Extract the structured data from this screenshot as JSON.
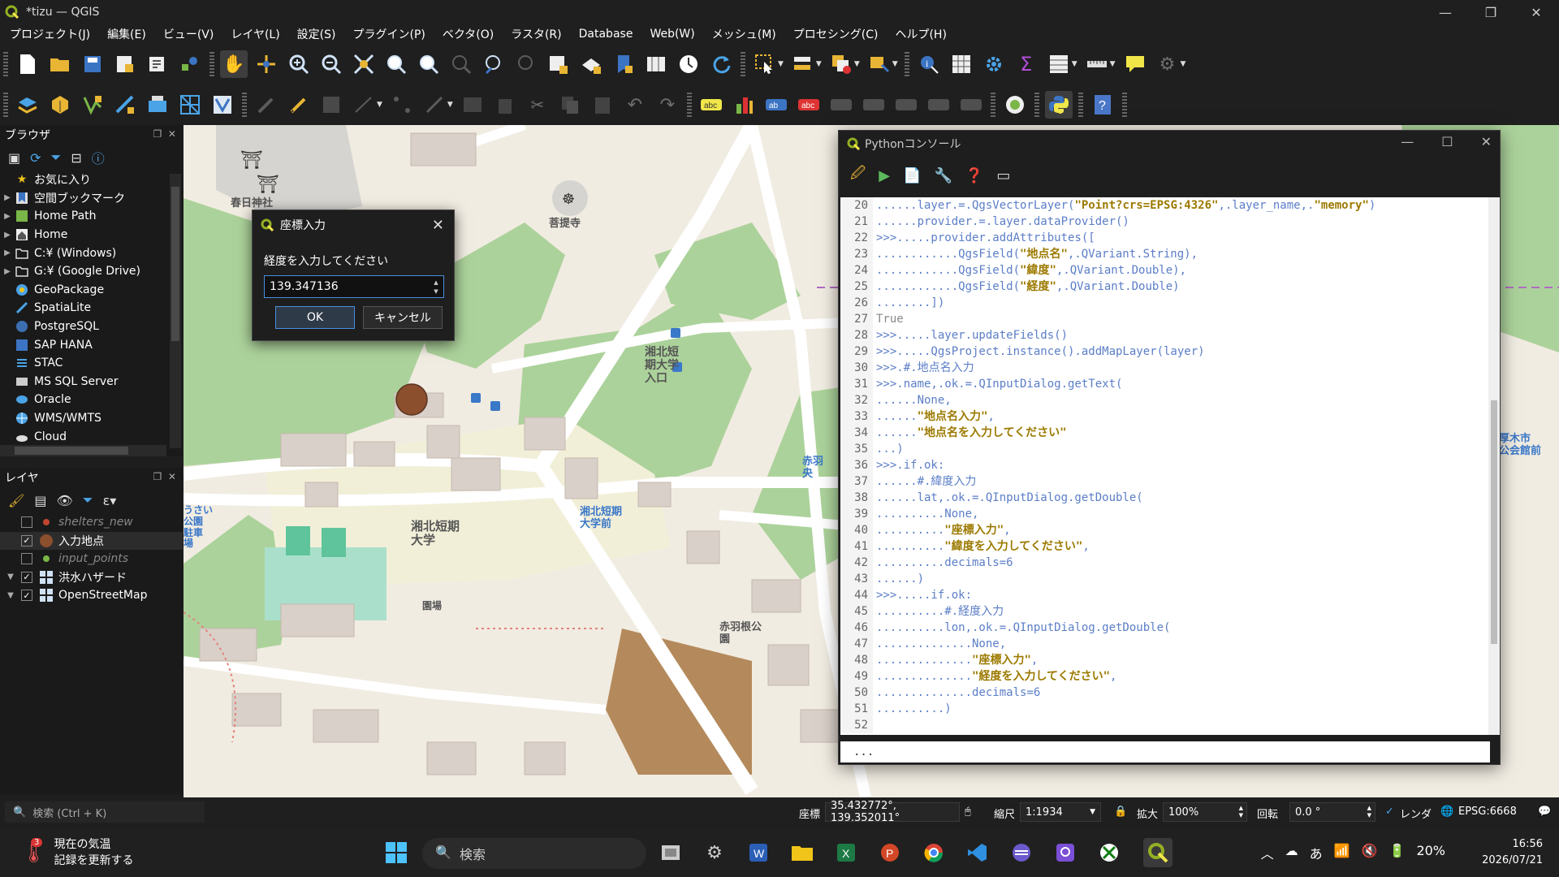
{
  "app": {
    "window_title": "*tizu — QGIS"
  },
  "menu": [
    "プロジェクト(J)",
    "編集(E)",
    "ビュー(V)",
    "レイヤ(L)",
    "設定(S)",
    "プラグイン(P)",
    "ベクタ(O)",
    "ラスタ(R)",
    "Database",
    "Web(W)",
    "メッシュ(M)",
    "プロセシング(C)",
    "ヘルプ(H)"
  ],
  "browser": {
    "title": "ブラウザ",
    "items": [
      "お気に入り",
      "空間ブックマーク",
      "Home Path",
      "Home",
      "C:¥ (Windows)",
      "G:¥ (Google Drive)",
      "GeoPackage",
      "SpatiaLite",
      "PostgreSQL",
      "SAP HANA",
      "STAC",
      "MS SQL Server",
      "Oracle",
      "WMS/WMTS",
      "Cloud"
    ]
  },
  "layers": {
    "title": "レイヤ",
    "items": [
      {
        "name": "shelters_new",
        "checked": false
      },
      {
        "name": "入力地点",
        "checked": true
      },
      {
        "name": "input_points",
        "checked": false
      },
      {
        "name": "洪水ハザード",
        "checked": true
      },
      {
        "name": "OpenStreetMap",
        "checked": true
      }
    ]
  },
  "map": {
    "labels": {
      "shrine": "春日神社",
      "temple": "菩提寺",
      "college": "湘北短期\n大学",
      "college_entrance": "湘北短\n期大学\n入口",
      "bus_stop": "湘北短期\n大学前",
      "park": "赤羽根公\n園",
      "city_hall_hint": "厚木市\n公会館前",
      "akabane": "赤羽\n央",
      "field": "園場",
      "park_left": "うさい\n公園\n駐車\n場"
    },
    "colors": {
      "land": "#f1ece2",
      "forest": "#acd29b",
      "road": "#ffffff",
      "building": "#d9d0c9",
      "marker": "#8b4f2e"
    }
  },
  "dialog": {
    "title": "座標入力",
    "prompt": "経度を入力してください",
    "value": "139.347136",
    "ok_label": "OK",
    "cancel_label": "キャンセル"
  },
  "console": {
    "title": "Pythonコンソール",
    "input_prompt": "...",
    "lines": [
      {
        "n": "20",
        "t": "......layer.=.QgsVectorLayer(\"Point?crs=EPSG:4326\",.layer_name,.\"memory\")"
      },
      {
        "n": "21",
        "t": "......provider.=.layer.dataProvider()"
      },
      {
        "n": "22",
        "t": ">>>.....provider.addAttributes(["
      },
      {
        "n": "23",
        "t": "............QgsField(\"地点名\",.QVariant.String),"
      },
      {
        "n": "24",
        "t": "............QgsField(\"緯度\",.QVariant.Double),"
      },
      {
        "n": "25",
        "t": "............QgsField(\"経度\",.QVariant.Double)"
      },
      {
        "n": "26",
        "t": "........])"
      },
      {
        "n": "27",
        "t": "True"
      },
      {
        "n": "28",
        "t": ">>>.....layer.updateFields()"
      },
      {
        "n": "29",
        "t": ">>>.....QgsProject.instance().addMapLayer(layer)"
      },
      {
        "n": "30",
        "t": ">>>.#.地点名入力"
      },
      {
        "n": "31",
        "t": ">>>.name,.ok.=.QInputDialog.getText("
      },
      {
        "n": "32",
        "t": "......None,"
      },
      {
        "n": "33",
        "t": "......\"地点名入力\","
      },
      {
        "n": "34",
        "t": "......\"地点名を入力してください\""
      },
      {
        "n": "35",
        "t": "...)"
      },
      {
        "n": "36",
        "t": ">>>.if.ok:"
      },
      {
        "n": "37",
        "t": "......#.緯度入力"
      },
      {
        "n": "38",
        "t": "......lat,.ok.=.QInputDialog.getDouble("
      },
      {
        "n": "39",
        "t": "..........None,"
      },
      {
        "n": "40",
        "t": "..........\"座標入力\","
      },
      {
        "n": "41",
        "t": "..........\"緯度を入力してください\","
      },
      {
        "n": "42",
        "t": "..........decimals=6"
      },
      {
        "n": "43",
        "t": "......)"
      },
      {
        "n": "44",
        "t": ">>>.....if.ok:"
      },
      {
        "n": "45",
        "t": "..........#.経度入力"
      },
      {
        "n": "46",
        "t": "..........lon,.ok.=.QInputDialog.getDouble("
      },
      {
        "n": "47",
        "t": "..............None,"
      },
      {
        "n": "48",
        "t": "..............\"座標入力\","
      },
      {
        "n": "49",
        "t": "..............\"経度を入力してください\","
      },
      {
        "n": "50",
        "t": "..............decimals=6"
      },
      {
        "n": "51",
        "t": "..........)"
      },
      {
        "n": "52",
        "t": ""
      }
    ]
  },
  "status": {
    "search_placeholder": "検索 (Ctrl + K)",
    "coord_label": "座標",
    "coord_value": "35.432772°, 139.352011°",
    "scale_label": "縮尺",
    "scale_value": "1:1934",
    "magnify_label": "拡大",
    "magnify_value": "100%",
    "rotation_label": "回転",
    "rotation_value": "0.0 °",
    "render_label": "レンダ",
    "crs": "EPSG:6668"
  },
  "taskbar": {
    "weather_title": "現在の気温",
    "weather_sub": "記録を更新する",
    "weather_badge": "3",
    "search_label": "検索",
    "ime": "あ",
    "battery": "20%",
    "time": "16:56",
    "date": "2026/07/21"
  }
}
